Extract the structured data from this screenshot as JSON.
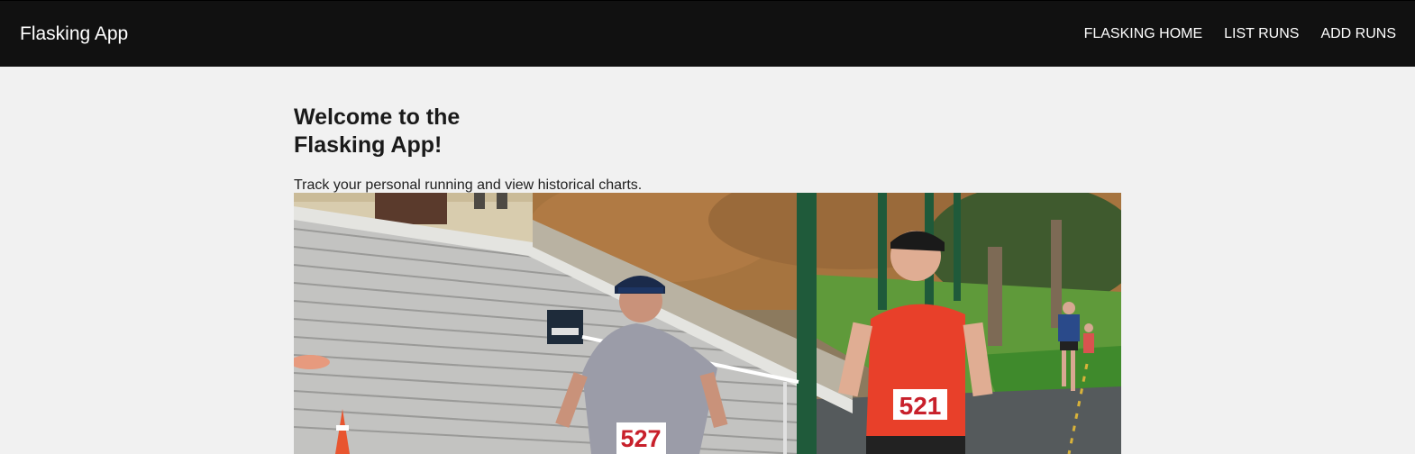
{
  "navbar": {
    "brand": "Flasking App",
    "links": [
      {
        "label": "FLASKING HOME"
      },
      {
        "label": "LIST RUNS"
      },
      {
        "label": "ADD RUNS"
      }
    ],
    "background_color": "#111111"
  },
  "main": {
    "title_line1": "Welcome to the",
    "title_line2": "Flasking App!",
    "subtitle": "Track your personal running and view historical charts.",
    "hero_image": {
      "bib_left": "527",
      "bib_right": "521"
    }
  }
}
